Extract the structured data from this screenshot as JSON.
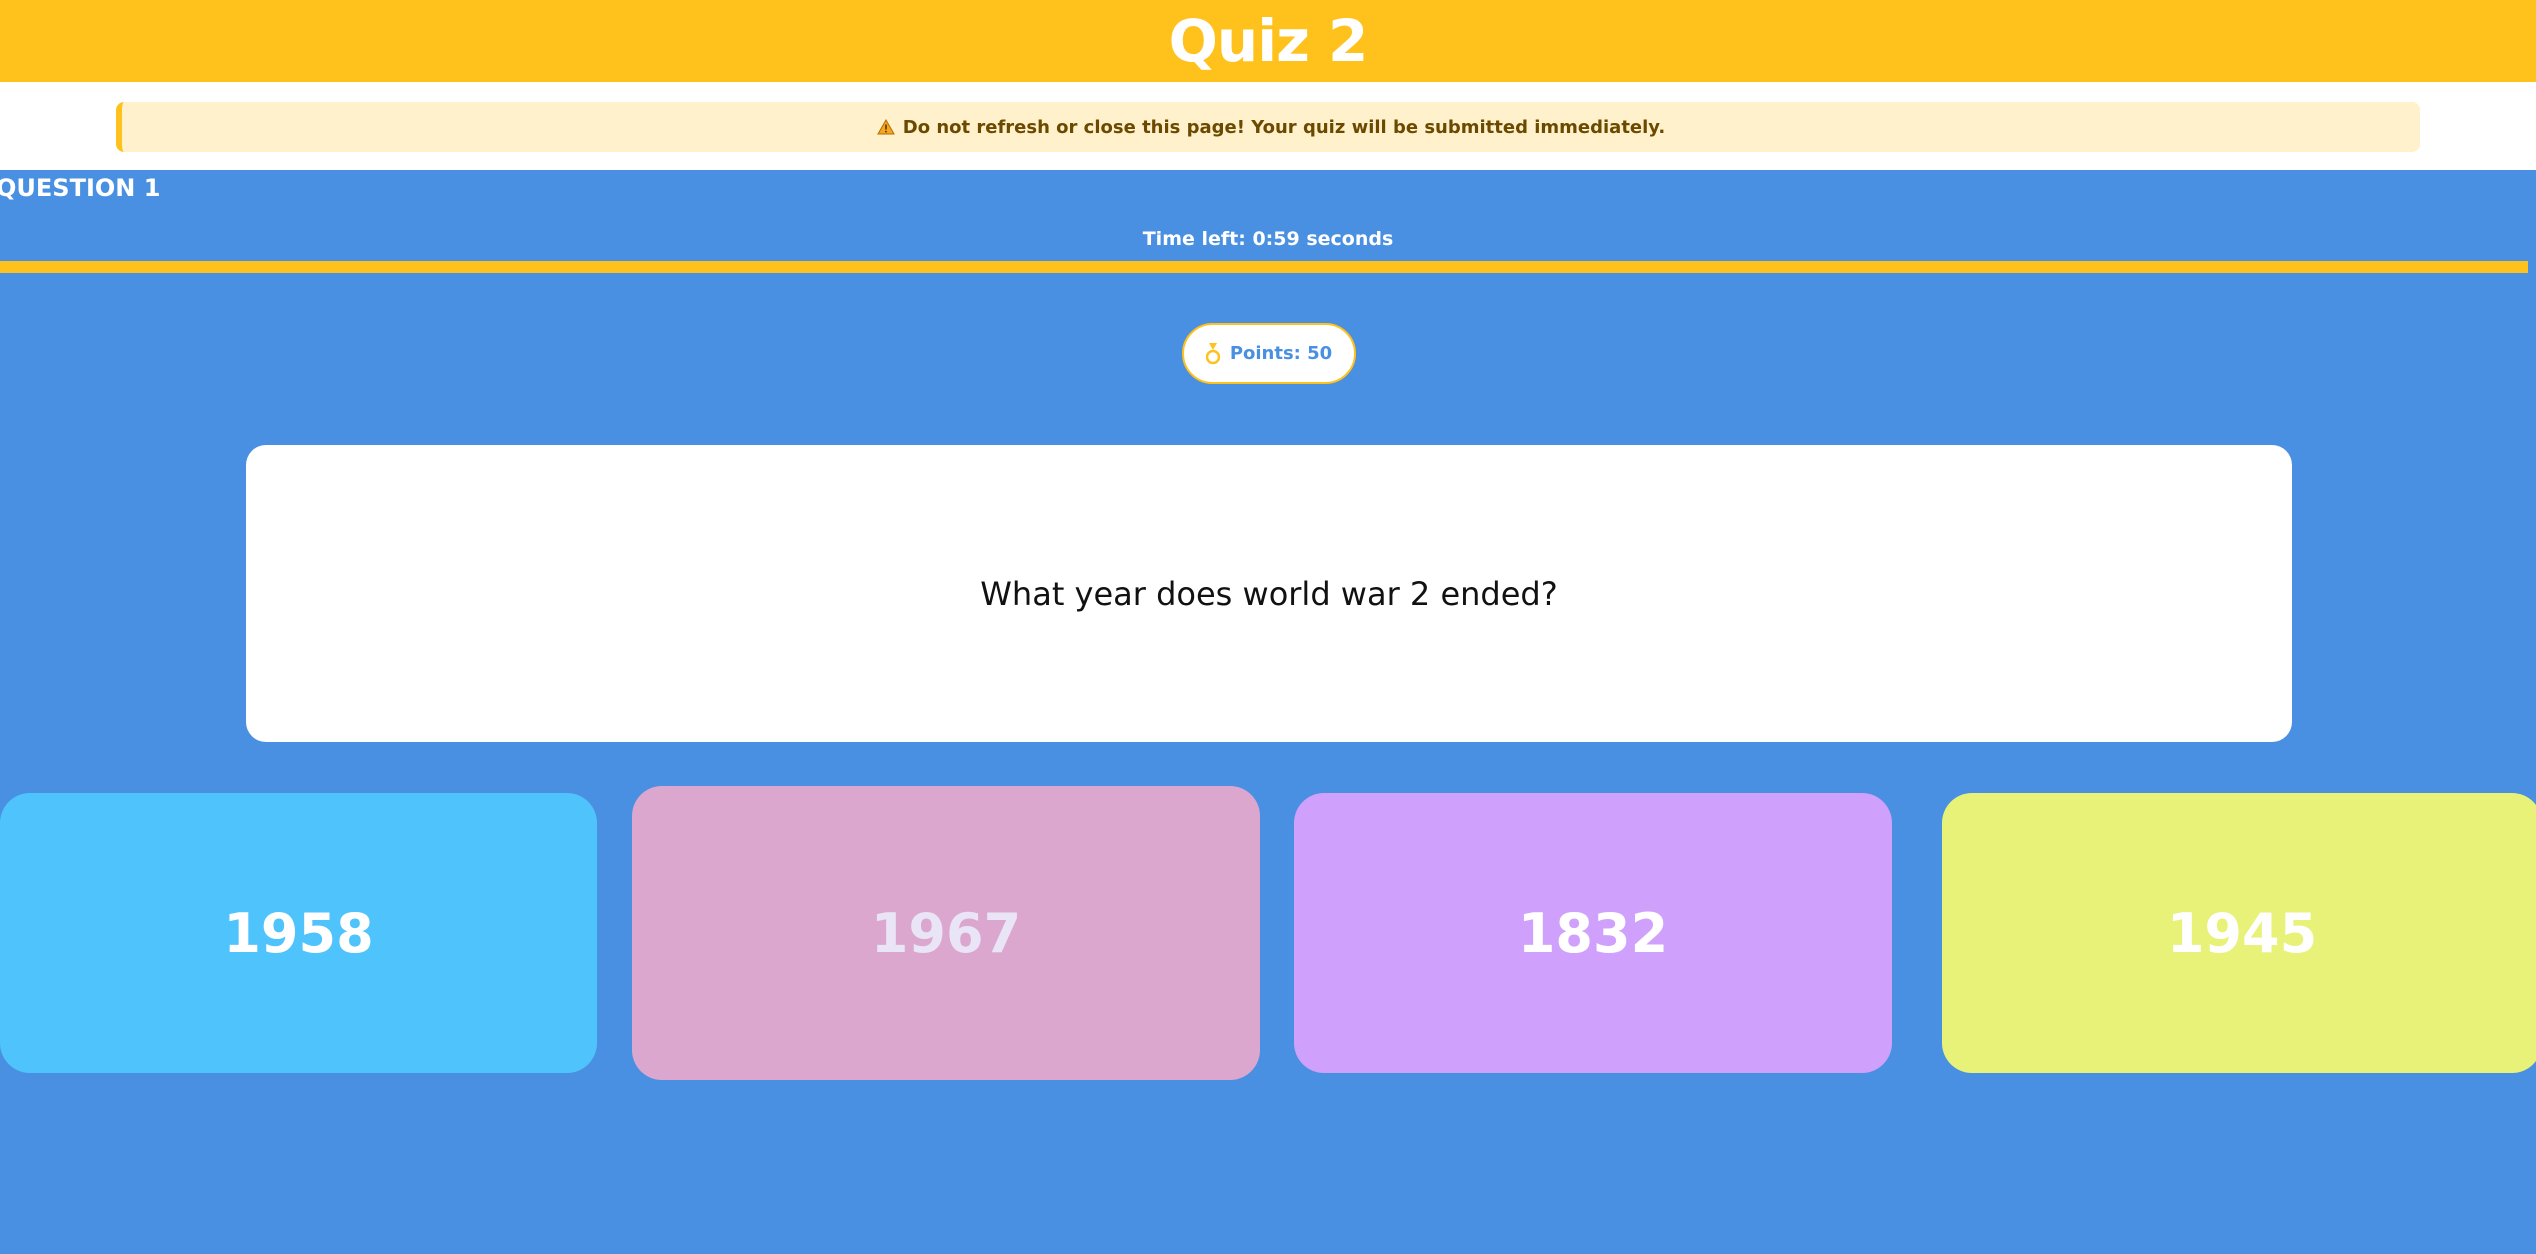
{
  "header": {
    "title": "Quiz 2"
  },
  "notice": {
    "icon": "warning-icon",
    "text": "Do not refresh or close this page! Your quiz will be submitted immediately."
  },
  "question": {
    "label": "QUESTION 1",
    "time_left": "Time left: 0:59 seconds",
    "timer_progress": 0.997,
    "points_icon": "medal-icon",
    "points_label": "Points: 50",
    "text": "What year does world war 2 ended?"
  },
  "answers": [
    {
      "label": "1958",
      "color": "#4fc3fb"
    },
    {
      "label": "1967",
      "color": "#dba7cf"
    },
    {
      "label": "1832",
      "color": "#d0a0fd"
    },
    {
      "label": "1945",
      "color": "#e8f178"
    }
  ],
  "colors": {
    "accent": "#ffc11c",
    "background": "#4a90e2",
    "notice_bg": "#fff1cc",
    "notice_text": "#6b4a00"
  }
}
